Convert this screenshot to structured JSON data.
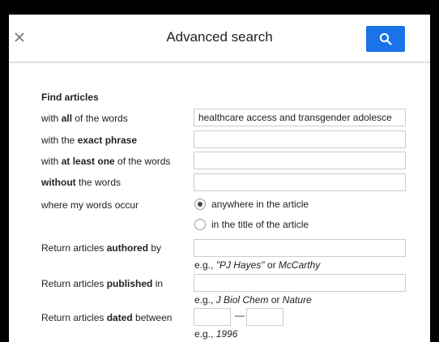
{
  "header": {
    "title": "Advanced search",
    "close_icon": "close-icon",
    "search_icon": "search-icon",
    "accent_color": "#1a73e8"
  },
  "form": {
    "section_title": "Find articles",
    "all_words": {
      "label_pre": "with ",
      "label_bold": "all",
      "label_post": " of the words",
      "value": "healthcare access and transgender adolesce"
    },
    "exact_phrase": {
      "label_pre": "with the ",
      "label_bold": "exact phrase",
      "label_post": "",
      "value": ""
    },
    "at_least_one": {
      "label_pre": "with ",
      "label_bold": "at least one",
      "label_post": " of the words",
      "value": ""
    },
    "without": {
      "label_pre": "",
      "label_bold": "without",
      "label_post": " the words",
      "value": ""
    },
    "occur": {
      "label": "where my words occur",
      "options": [
        {
          "label": "anywhere in the article",
          "selected": true
        },
        {
          "label": "in the title of the article",
          "selected": false
        }
      ]
    },
    "authored": {
      "label_pre": "Return articles ",
      "label_bold": "authored",
      "label_post": " by",
      "value": "",
      "hint_pre": "e.g., ",
      "hint_italic": "\"PJ Hayes\"",
      "hint_mid": " or ",
      "hint_italic2": "McCarthy"
    },
    "published": {
      "label_pre": "Return articles ",
      "label_bold": "published",
      "label_post": " in",
      "value": "",
      "hint_pre": "e.g., ",
      "hint_italic": "J Biol Chem",
      "hint_mid": " or ",
      "hint_italic2": "Nature"
    },
    "dated": {
      "label_pre": "Return articles ",
      "label_bold": "dated",
      "label_post": " between",
      "from_value": "",
      "to_value": "",
      "separator": "—",
      "hint_pre": "e.g., ",
      "hint_italic": "1996"
    }
  }
}
